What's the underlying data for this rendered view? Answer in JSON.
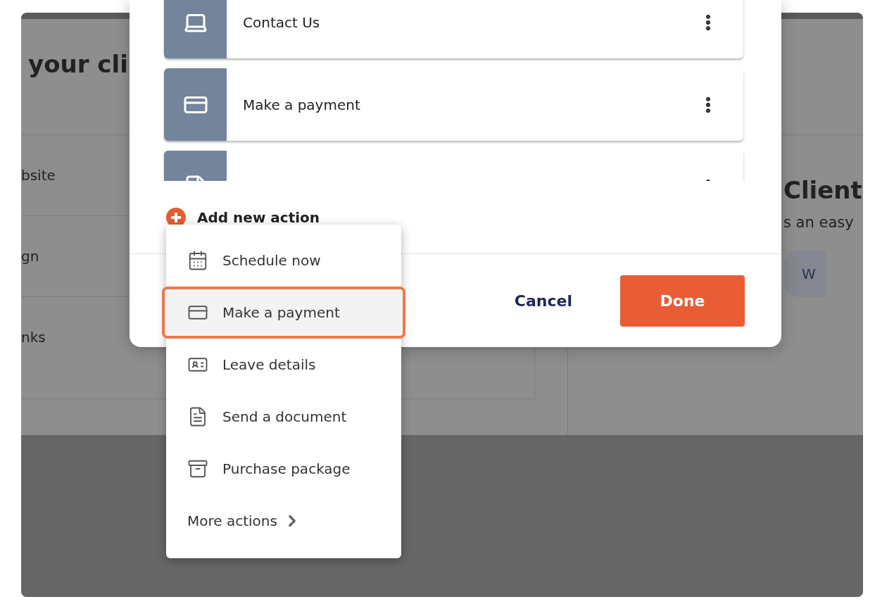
{
  "background": {
    "heading": "your cli",
    "rows": [
      "bsite",
      "gn",
      "nks"
    ],
    "card_title": "Client",
    "card_text": "s an easy",
    "card_button": "W"
  },
  "modal": {
    "actions": [
      {
        "kind": "computer",
        "label": "Contact Us"
      },
      {
        "kind": "card",
        "label": "Make a payment"
      },
      {
        "kind": "document"
      }
    ],
    "add_action": "Add new action",
    "cancel": "Cancel",
    "done": "Done"
  },
  "menu": {
    "items": [
      {
        "kind": "calendar",
        "label": "Schedule now",
        "selected": false
      },
      {
        "kind": "card",
        "label": "Make a payment",
        "selected": true
      },
      {
        "kind": "contact",
        "label": "Leave details",
        "selected": false
      },
      {
        "kind": "document",
        "label": "Send a document",
        "selected": false
      },
      {
        "kind": "package",
        "label": "Purchase package",
        "selected": false
      }
    ],
    "more": "More actions"
  }
}
